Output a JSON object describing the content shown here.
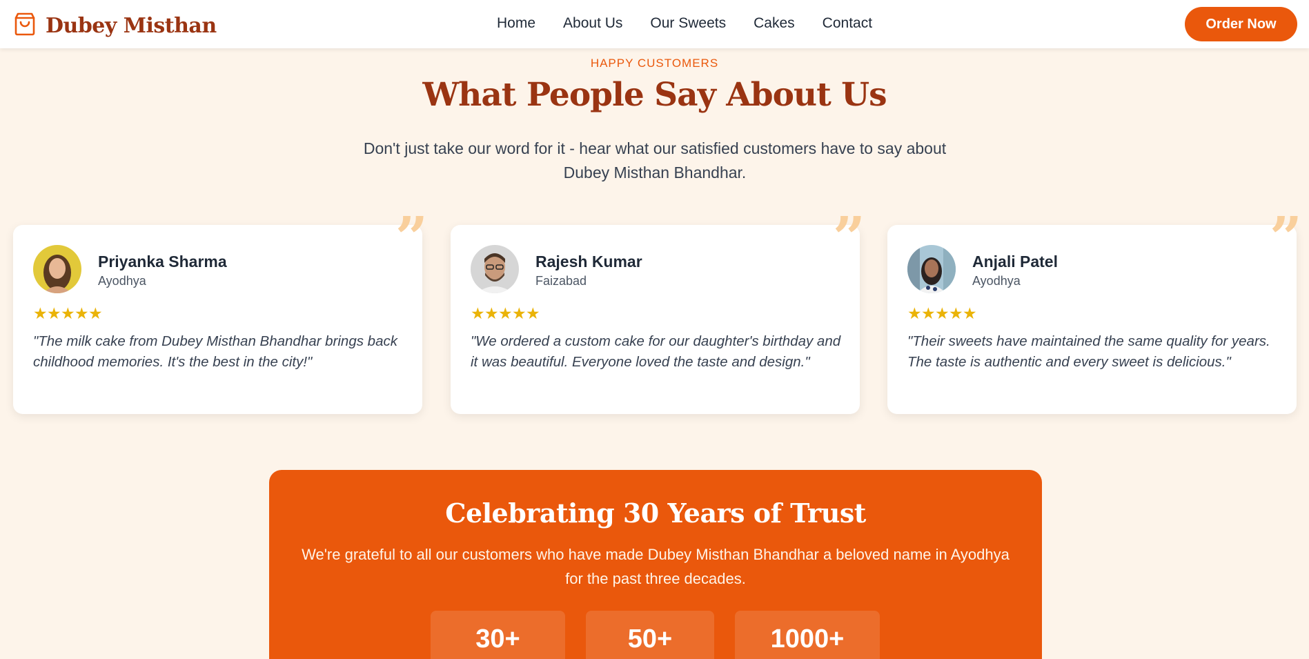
{
  "brand": {
    "name": "Dubey Misthan",
    "logo_icon": "shopping-bag-icon",
    "accent": "#ea580c",
    "title_color": "#9a3412"
  },
  "nav": [
    {
      "label": "Home"
    },
    {
      "label": "About Us"
    },
    {
      "label": "Our Sweets"
    },
    {
      "label": "Cakes"
    },
    {
      "label": "Contact"
    }
  ],
  "header": {
    "order_label": "Order Now"
  },
  "testimonials_section": {
    "eyebrow": "HAPPY CUSTOMERS",
    "title": "What People Say About Us",
    "subtitle": "Don't just take our word for it - hear what our satisfied customers have to say about Dubey Misthan Bhandhar.",
    "quote_glyph": "”",
    "cards": [
      {
        "name": "Priyanka Sharma",
        "city": "Ayodhya",
        "rating": 5,
        "stars": "★★★★★",
        "text": "\"The milk cake from Dubey Misthan Bhandhar brings back childhood memories. It's the best in the city!\""
      },
      {
        "name": "Rajesh Kumar",
        "city": "Faizabad",
        "rating": 5,
        "stars": "★★★★★",
        "text": "\"We ordered a custom cake for our daughter's birthday and it was beautiful. Everyone loved the taste and design.\""
      },
      {
        "name": "Anjali Patel",
        "city": "Ayodhya",
        "rating": 5,
        "stars": "★★★★★",
        "text": "\"Their sweets have maintained the same quality for years. The taste is authentic and every sweet is delicious.\""
      }
    ]
  },
  "trust_banner": {
    "title": "Celebrating 30 Years of Trust",
    "subtitle": "We're grateful to all our customers who have made Dubey Misthan Bhandhar a beloved name in Ayodhya for the past three decades.",
    "stats": [
      {
        "value": "30+"
      },
      {
        "value": "50+"
      },
      {
        "value": "1000+"
      }
    ]
  }
}
